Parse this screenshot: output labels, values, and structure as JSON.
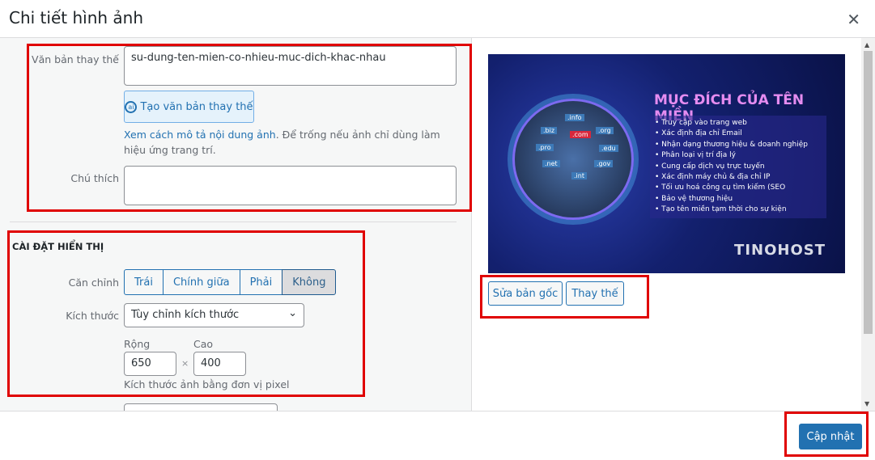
{
  "header": {
    "title": "Chi tiết hình ảnh",
    "close_icon": "close-icon"
  },
  "alt": {
    "label": "Văn bản thay thế",
    "value": "su-dung-ten-mien-co-nhieu-muc-dich-khac-nhau",
    "ai_button": "Tạo văn bản thay thế",
    "help_link": "Xem cách mô tả nội dung ảnh",
    "help_text": ". Để trống nếu ảnh chỉ dùng làm hiệu ứng trang trí."
  },
  "caption": {
    "label": "Chú thích",
    "value": ""
  },
  "display": {
    "heading": "CÀI ĐẶT HIỂN THỊ",
    "align_label": "Căn chỉnh",
    "align_options": [
      "Trái",
      "Chính giữa",
      "Phải",
      "Không"
    ],
    "align_selected": "Không",
    "size_label": "Kích thước",
    "size_value": "Tùy chỉnh kích thước",
    "width_label": "Rộng",
    "height_label": "Cao",
    "width_value": "650",
    "height_value": "400",
    "times": "×",
    "size_help": "Kích thước ảnh bằng đơn vị pixel"
  },
  "image": {
    "title": "MỤC ĐÍCH CỦA TÊN MIỀN",
    "items": [
      "Truy cập vào trang web",
      "Xác định địa chỉ Email",
      "Nhận dạng thương hiệu & doanh nghiệp",
      "Phân loại vị trí địa lý",
      "Cung cấp dịch vụ trực tuyến",
      "Xác định máy chủ & địa chỉ IP",
      "Tối ưu hoá công cụ tìm kiếm (SEO",
      "Bảo vệ thương hiệu",
      "Tạo tên miền tạm thời cho sự kiện"
    ],
    "tlds": [
      ".info",
      ".biz",
      ".com",
      ".org",
      ".pro",
      ".edu",
      ".net",
      ".gov",
      ".int"
    ],
    "logo": "TINOHOST"
  },
  "image_actions": {
    "edit": "Sửa bản gốc",
    "replace": "Thay thế"
  },
  "footer": {
    "update": "Cập nhật"
  },
  "colors": {
    "accent": "#2271b1",
    "highlight": "#e00000"
  }
}
